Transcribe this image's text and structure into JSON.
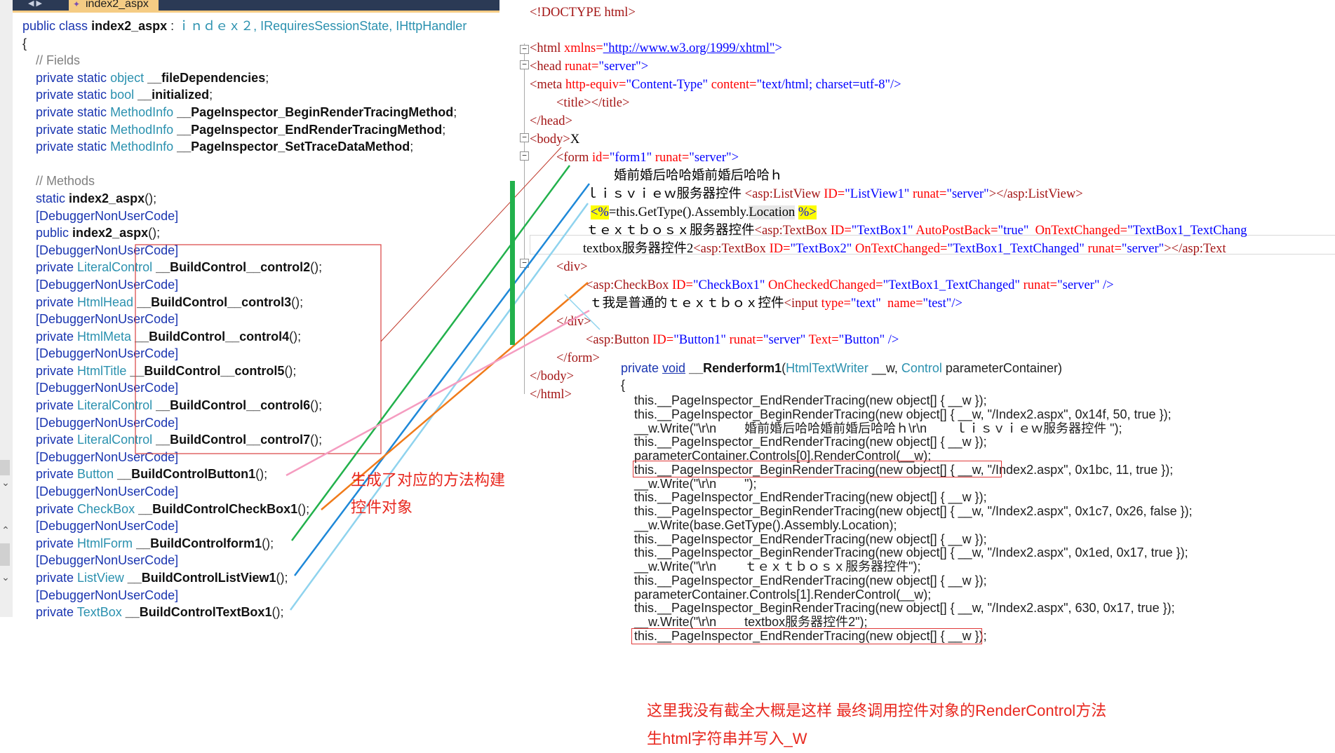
{
  "left": {
    "tab_label": "index2_aspx",
    "class_decl": {
      "public": "public",
      "class": "class",
      "name": "index2_aspx",
      "colon": " : ",
      "base": "ｉｎｄｅｘ２",
      "ifaces": ", IRequiresSessionState, IHttpHandler"
    },
    "open_brace": "{",
    "fields_comment": "// Fields",
    "fields": [
      {
        "mods": "private static",
        "type": "object",
        "name": "__fileDependencies"
      },
      {
        "mods": "private static",
        "type": "bool",
        "name": "__initialized"
      },
      {
        "mods": "private static",
        "type": "MethodInfo",
        "name": "__PageInspector_BeginRenderTracingMethod"
      },
      {
        "mods": "private static",
        "type": "MethodInfo",
        "name": "__PageInspector_EndRenderTracingMethod"
      },
      {
        "mods": "private static",
        "type": "MethodInfo",
        "name": "__PageInspector_SetTraceDataMethod"
      }
    ],
    "methods_comment": "// Methods",
    "static_ctor": {
      "mods": "static",
      "name": "index2_aspx",
      "tail": "();"
    },
    "attr": "[DebuggerNonUserCode]",
    "public_ctor": {
      "mods": "public",
      "name": "index2_aspx",
      "tail": "();"
    },
    "methods": [
      {
        "type": "LiteralControl",
        "name": "__BuildControl__control2"
      },
      {
        "type": "HtmlHead",
        "name": "__BuildControl__control3"
      },
      {
        "type": "HtmlMeta",
        "name": "__BuildControl__control4"
      },
      {
        "type": "HtmlTitle",
        "name": "__BuildControl__control5"
      },
      {
        "type": "LiteralControl",
        "name": "__BuildControl__control6"
      },
      {
        "type": "LiteralControl",
        "name": "__BuildControl__control7"
      },
      {
        "type": "Button",
        "name": "__BuildControlButton1"
      },
      {
        "type": "CheckBox",
        "name": "__BuildControlCheckBox1"
      },
      {
        "type": "HtmlForm",
        "name": "__BuildControlform1"
      },
      {
        "type": "ListView",
        "name": "__BuildControlListView1"
      },
      {
        "type": "TextBox",
        "name": "__BuildControlTextBox1"
      }
    ],
    "private": "private",
    "call_tail": "();"
  },
  "markup": {
    "doctype": "<!DOCTYPE html>",
    "html_open": {
      "tag": "<html",
      "attr": "xmlns=",
      "val": "\"http://www.w3.org/1999/xhtml\"",
      "close": ">"
    },
    "head_open": {
      "tag": "<head",
      "attr": "runat=",
      "val": "\"server\"",
      "close": ">"
    },
    "meta": {
      "tag": "<meta",
      "a1": "http-equiv=",
      "v1": "\"Content-Type\"",
      "a2": "content=",
      "v2": "\"text/html; charset=utf-8\"",
      "close": "/>"
    },
    "title": "<title></title>",
    "head_close": "</head>",
    "body_open": "<body>",
    "body_x": "X",
    "form_open": {
      "tag": "<form",
      "a1": "id=",
      "v1": "\"form1\"",
      "a2": "runat=",
      "v2": "\"server\"",
      "close": ">"
    },
    "text_line": "婚前婚后哈哈婚前婚后哈哈ｈ",
    "listview_line": {
      "text": "ｌｉｓｖｉｅｗ服务器控件 ",
      "tag": "<asp:ListView",
      "a1": "ID=",
      "v1": "\"ListView1\"",
      "a2": "runat=",
      "v2": "\"server\"",
      "close": "></asp:ListView>"
    },
    "location_line": {
      "open": "<%",
      "code": "=this.GetType().Assembly.",
      "prop": "Location",
      "close": "%>"
    },
    "textbox1_line": {
      "text": "ｔｅｘｔｂｏｓｘ服务器控件",
      "tag": "<asp:TextBox",
      "a1": "ID=",
      "v1": "\"TextBox1\"",
      "a2": "AutoPostBack=",
      "v2": "\"true\"",
      "a3": "OnTextChanged=",
      "v3": "\"TextBox1_TextChang"
    },
    "textbox2_line": {
      "text": "textbox服务器控件2",
      "tag": "<asp:TextBox",
      "a1": "ID=",
      "v1": "\"TextBox2\"",
      "a2": "OnTextChanged=",
      "v2": "\"TextBox1_TextChanged\"",
      "a3": "runat=",
      "v3": "\"server\"",
      "close": "></asp:Text"
    },
    "div_open": "<div>",
    "checkbox_line": {
      "tag": "<asp:CheckBox",
      "a1": "ID=",
      "v1": "\"CheckBox1\"",
      "a2": "OnCheckedChanged=",
      "v2": "\"TextBox1_TextChanged\"",
      "a3": "runat=",
      "v3": "\"server\"",
      "close": "/>"
    },
    "input_line": {
      "text": "ｔ我是普通的ｔｅｘｔｂｏｘ控件",
      "tag": "<input",
      "a1": "type=",
      "v1": "\"text\"",
      "a2": "name=",
      "v2": "\"test\"",
      "close": "/>"
    },
    "div_close": "</div>",
    "button_line": {
      "tag": "<asp:Button",
      "a1": "ID=",
      "v1": "\"Button1\"",
      "a2": "runat=",
      "v2": "\"server\"",
      "a3": "Text=",
      "v3": "\"Button\"",
      "close": "/>"
    },
    "form_close": "</form>",
    "body_close": "</body>",
    "html_close": "</html>"
  },
  "render": {
    "sig": {
      "mod": "private",
      "void": "void",
      "name": "__Renderform1",
      "open": "(",
      "t1": "HtmlTextWriter",
      "p1": " __w, ",
      "t2": "Control",
      "p2": " parameterContainer)"
    },
    "brace": "{",
    "lines": [
      "this.__PageInspector_EndRenderTracing(new object[] { __w });",
      "this.__PageInspector_BeginRenderTracing(new object[] { __w, \"/Index2.aspx\", 0x14f, 50, true });",
      "__w.Write(\"\\r\\n        婚前婚后哈哈婚前婚后哈哈ｈ\\r\\n        ｌｉｓｖｉｅｗ服务器控件 \");",
      "this.__PageInspector_EndRenderTracing(new object[] { __w });",
      "parameterContainer.Controls[0].RenderControl(__w);",
      "this.__PageInspector_BeginRenderTracing(new object[] { __w, \"/Index2.aspx\", 0x1bc, 11, true });",
      "__w.Write(\"\\r\\n        \");",
      "this.__PageInspector_EndRenderTracing(new object[] { __w });",
      "this.__PageInspector_BeginRenderTracing(new object[] { __w, \"/Index2.aspx\", 0x1c7, 0x26, false });",
      "__w.Write(base.GetType().Assembly.Location);",
      "this.__PageInspector_EndRenderTracing(new object[] { __w });",
      "this.__PageInspector_BeginRenderTracing(new object[] { __w, \"/Index2.aspx\", 0x1ed, 0x17, true });",
      "__w.Write(\"\\r\\n        ｔｅｘｔｂｏｓｘ服务器控件\");",
      "this.__PageInspector_EndRenderTracing(new object[] { __w });",
      "parameterContainer.Controls[1].RenderControl(__w);",
      "this.__PageInspector_BeginRenderTracing(new object[] { __w, \"/Index2.aspx\", 630, 0x17, true });",
      "__w.Write(\"\\r\\n        textbox服务器控件2\");",
      "this.__PageInspector_EndRenderTracing(new object[] { __w });"
    ]
  },
  "annotations": {
    "left_note_1": "生成了对应的方法构建",
    "left_note_2": "控件对象",
    "bottom_note_1": "这里我没有截全大概是这样 最终调用控件对象的RenderControl方法",
    "bottom_note_2": "生html字符串并写入_W"
  },
  "colors": {
    "annotation_red": "#e8281f",
    "green_line": "#22b14c",
    "blue_line": "#1e88d8",
    "light_blue_line": "#8fd3ee",
    "orange_line": "#f07b1a",
    "pink_line": "#f59cc0",
    "dark_red_line": "#c0392b"
  }
}
